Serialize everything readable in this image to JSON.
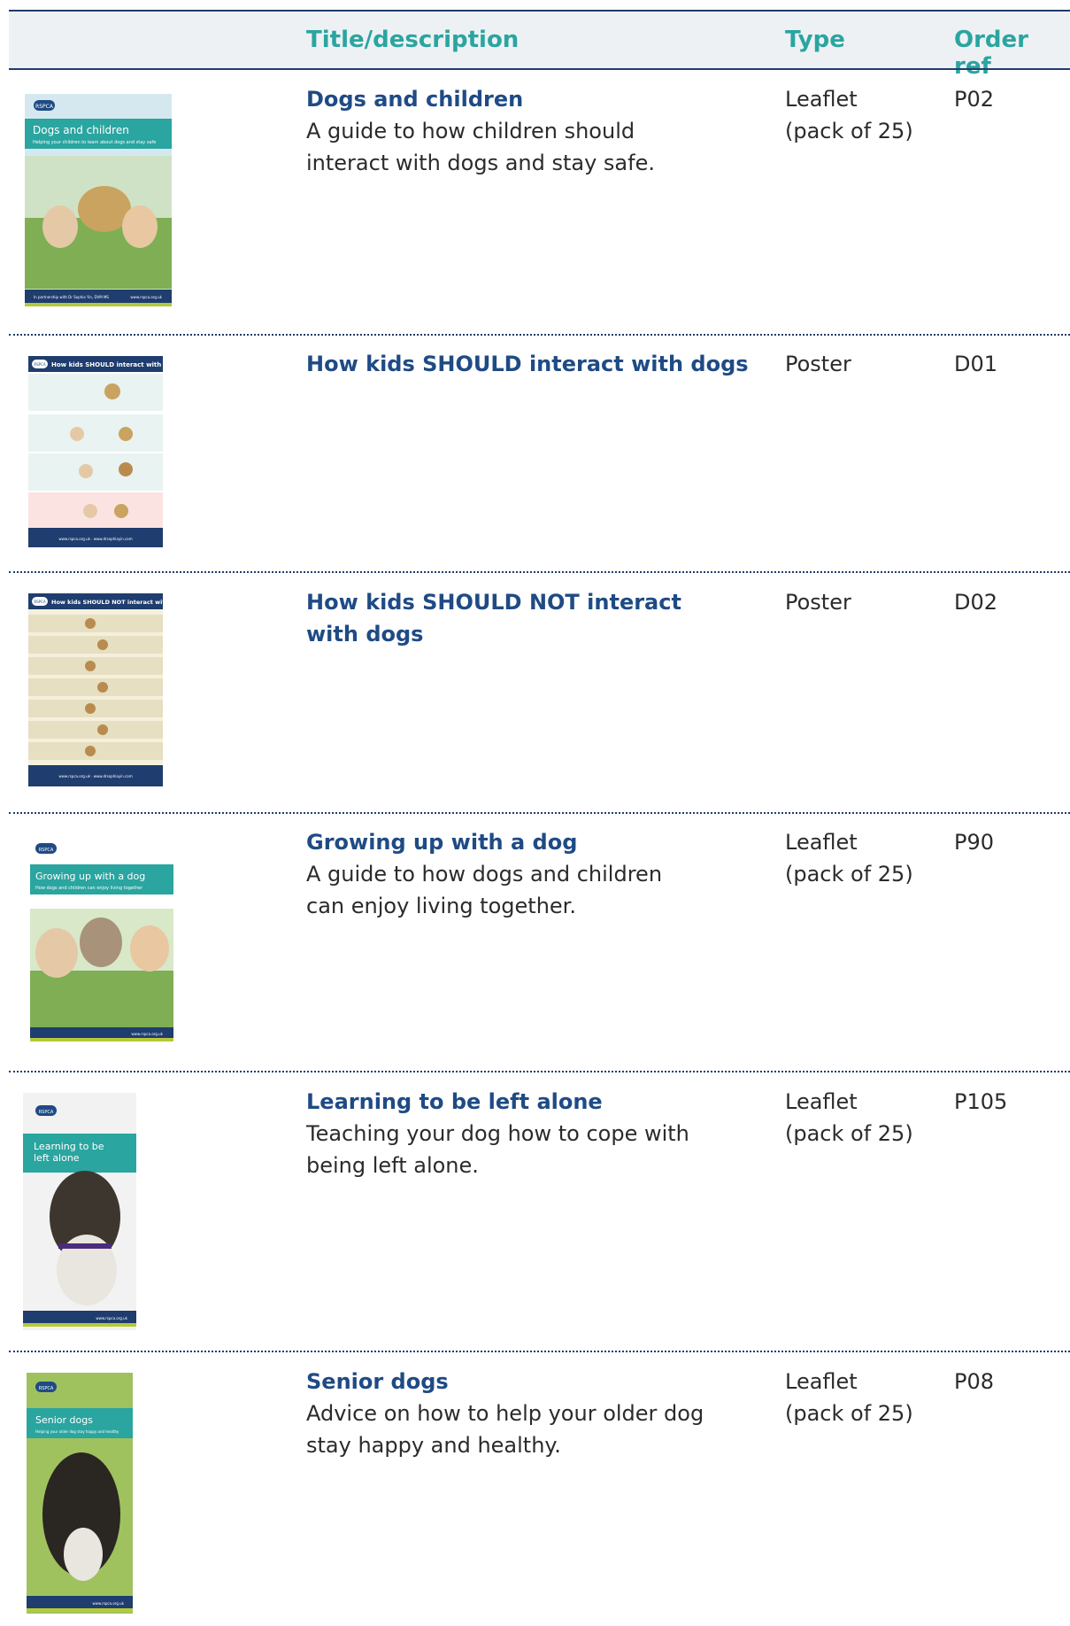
{
  "table": {
    "headers": {
      "title": "Title/description",
      "type": "Type",
      "ref": "Order ref"
    },
    "rows": [
      {
        "title": "Dogs and children",
        "desc_lines": [
          "A guide to how children should",
          "interact with dogs and stay safe."
        ],
        "type_lines": [
          "Leaflet",
          "(pack of 25)"
        ],
        "ref": "P02",
        "thumb": {
          "logo": "RSPCA",
          "banner": "Dogs and children",
          "sub": "Helping your children to learn about dogs and stay safe",
          "footer": "www.rspca.org.uk",
          "footer_left": "In partnership with Dr Sophia Yin, DVM MS"
        }
      },
      {
        "title": "How kids SHOULD interact with dogs",
        "desc_lines": [],
        "type_lines": [
          "Poster"
        ],
        "ref": "D01",
        "thumb": {
          "logo": "RSPCA",
          "banner": "How kids SHOULD interact with dogs",
          "footer": "www.rspca.org.uk · www.drsophiayin.com"
        }
      },
      {
        "title_lines": [
          "How kids SHOULD NOT interact",
          "with dogs"
        ],
        "desc_lines": [],
        "type_lines": [
          "Poster"
        ],
        "ref": "D02",
        "thumb": {
          "logo": "RSPCA",
          "banner": "How kids SHOULD NOT interact with dogs",
          "footer": "www.rspca.org.uk · www.drsophiayin.com"
        }
      },
      {
        "title": "Growing up with a dog",
        "desc_lines": [
          "A guide to how dogs and children",
          "can enjoy living together."
        ],
        "type_lines": [
          "Leaflet",
          "(pack of 25)"
        ],
        "ref": "P90",
        "thumb": {
          "logo": "RSPCA",
          "banner": "Growing up with a dog",
          "sub": "How dogs and children can enjoy living together",
          "footer": "www.rspca.org.uk"
        }
      },
      {
        "title": "Learning to be left alone",
        "desc_lines": [
          "Teaching your dog how to cope with",
          "being left alone."
        ],
        "type_lines": [
          "Leaflet",
          "(pack of 25)"
        ],
        "ref": "P105",
        "thumb": {
          "logo": "RSPCA",
          "banner_lines": [
            "Learning to be",
            "left alone"
          ],
          "footer": "www.rspca.org.uk"
        }
      },
      {
        "title": "Senior dogs",
        "desc_lines": [
          "Advice on how to help your older dog",
          "stay happy and healthy."
        ],
        "type_lines": [
          "Leaflet",
          "(pack of 25)"
        ],
        "ref": "P08",
        "thumb": {
          "logo": "RSPCA",
          "banner": "Senior dogs",
          "sub": "Helping your older dog stay happy and healthy",
          "footer": "www.rspca.org.uk"
        }
      }
    ]
  },
  "colors": {
    "navy": "#1f3d6e",
    "teal": "#2aa5a0",
    "title_blue": "#1f4b85",
    "green_accent": "#b6c936"
  }
}
